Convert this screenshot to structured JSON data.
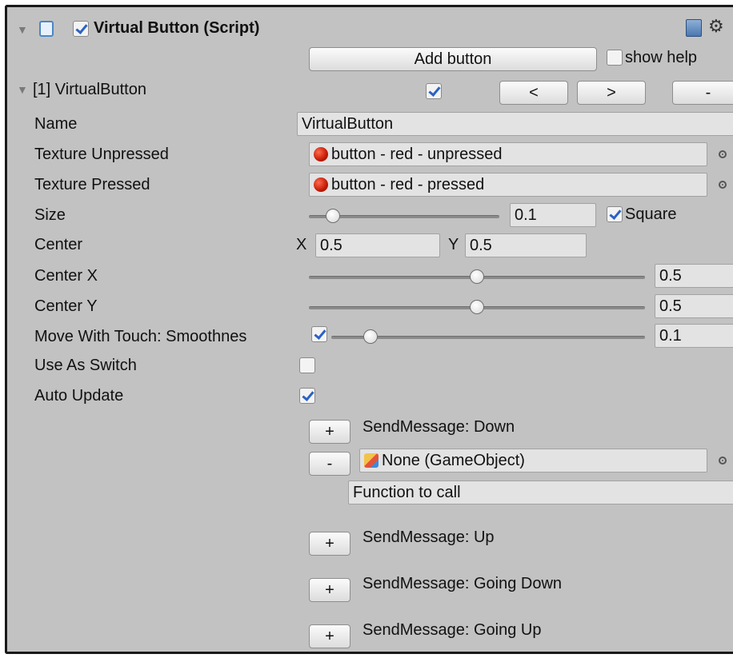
{
  "header": {
    "title": "Virtual Button (Script)",
    "enabled": true
  },
  "toolbar": {
    "add_button_label": "Add button",
    "show_help_label": "show help",
    "show_help_checked": false
  },
  "button_entry": {
    "label": "[1] VirtualButton",
    "enabled": true,
    "prev_label": "<",
    "next_label": ">",
    "remove_label": "-"
  },
  "fields": {
    "name_label": "Name",
    "name_value": "VirtualButton",
    "texture_unpressed_label": "Texture Unpressed",
    "texture_unpressed_value": "button - red - unpressed",
    "texture_pressed_label": "Texture Pressed",
    "texture_pressed_value": "button - red - pressed",
    "size_label": "Size",
    "size_value": "0.1",
    "size_slider_fraction": 0.1,
    "square_label": "Square",
    "square_checked": true,
    "center_label": "Center",
    "center_x_prefix": "X",
    "center_x_value": "0.5",
    "center_y_prefix": "Y",
    "center_y_value": "0.5",
    "center_x_label": "Center X",
    "center_x_slider_value": "0.5",
    "center_x_slider_fraction": 0.5,
    "center_y_label": "Center Y",
    "center_y_slider_value": "0.5",
    "center_y_slider_fraction": 0.5,
    "move_with_touch_label": "Move With Touch: Smoothnes",
    "move_with_touch_checked": true,
    "move_with_touch_value": "0.1",
    "move_with_touch_fraction": 0.1,
    "use_as_switch_label": "Use As Switch",
    "use_as_switch_checked": false,
    "auto_update_label": "Auto Update",
    "auto_update_checked": true
  },
  "messages": {
    "plus": "+",
    "minus": "-",
    "down_label": "SendMessage: Down",
    "target_value": "None (GameObject)",
    "function_placeholder": "Function to call",
    "up_label": "SendMessage: Up",
    "going_down_label": "SendMessage: Going Down",
    "going_up_label": "SendMessage: Going Up"
  },
  "icons": {
    "collapse": "triangle-down-icon",
    "script": "script-icon",
    "help": "book-icon",
    "settings": "gear-icon",
    "texture": "red-sphere-icon",
    "gameobject": "cube-icon",
    "picker": "object-picker-icon"
  }
}
